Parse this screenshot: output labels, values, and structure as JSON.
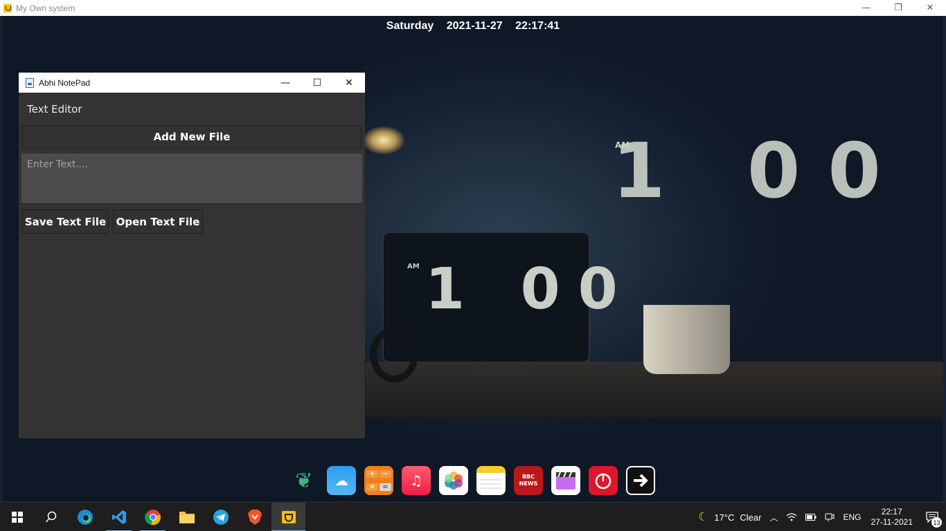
{
  "outer_window": {
    "title": "My Own system",
    "minimize": "—",
    "restore": "❐",
    "close": "✕"
  },
  "desktop": {
    "day": "Saturday",
    "date": "2021-11-27",
    "time": "22:17:41"
  },
  "notepad": {
    "title": "Abhi NotePad",
    "minimize": "—",
    "maximize": "☐",
    "close": "✕",
    "section_label": "Text Editor",
    "add_button": "Add New File",
    "text_placeholder": "Enter Text....",
    "save_button": "Save Text File",
    "open_button": "Open Text File"
  },
  "dock": {
    "items": [
      {
        "name": "leaf-app",
        "icon": "leaf-icon"
      },
      {
        "name": "weather-app",
        "icon": "cloud-icon"
      },
      {
        "name": "calculator-app",
        "icon": "calculator-icon"
      },
      {
        "name": "music-app",
        "icon": "music-note-icon"
      },
      {
        "name": "photos-app",
        "icon": "photos-icon"
      },
      {
        "name": "notes-app",
        "icon": "notes-icon"
      },
      {
        "name": "bbc-news-app",
        "icon": "bbc-news-icon",
        "text_top": "BBC",
        "text_bottom": "NEWS"
      },
      {
        "name": "clips-app",
        "icon": "clapperboard-icon"
      },
      {
        "name": "power-app",
        "icon": "power-icon"
      },
      {
        "name": "exit-app",
        "icon": "arrow-right-icon"
      }
    ]
  },
  "taskbar": {
    "weather_temp": "17°C",
    "weather_text": "Clear",
    "language": "ENG",
    "time": "22:17",
    "date": "27-11-2021",
    "notification_count": "13"
  }
}
